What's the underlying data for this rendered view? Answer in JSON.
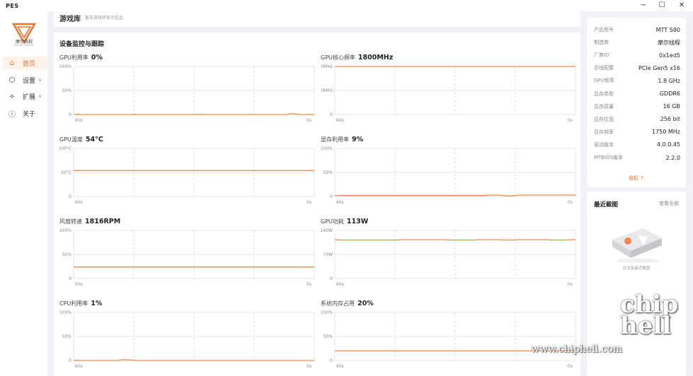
{
  "app": {
    "title": "PES"
  },
  "window": {
    "minimize": "−",
    "maximize": "☐",
    "close": "✕"
  },
  "logo": {
    "text": "摩尔线程",
    "subtext": "MOORE THREADS"
  },
  "sidebar": {
    "items": [
      {
        "label": "首页",
        "icon": "home-icon",
        "active": true
      },
      {
        "label": "设置",
        "icon": "settings-icon",
        "chevron": "∨"
      },
      {
        "label": "扩展",
        "icon": "extension-icon",
        "chevron": "∨"
      },
      {
        "label": "关于",
        "icon": "info-icon"
      }
    ]
  },
  "top_card": {
    "title": "游戏库",
    "subtitle": "暂无游戏将显示在此"
  },
  "monitor": {
    "title": "设备监控与跟踪",
    "charts": [
      {
        "label": "GPU利用率",
        "value": "0%",
        "y_ticks": [
          "100%",
          "50%",
          "0"
        ],
        "x_start": "60s",
        "x_end": "0s",
        "series": [
          0,
          0.4,
          0,
          0,
          0,
          0,
          0,
          0,
          0,
          0,
          0,
          0,
          0,
          0,
          0,
          0.3,
          0,
          0,
          0,
          0,
          0,
          0,
          0,
          0,
          0,
          0,
          0,
          0,
          0,
          0,
          0,
          0.3,
          0.5,
          0,
          0,
          0,
          0,
          0,
          0,
          0,
          0,
          0,
          0,
          0,
          0,
          0.5,
          0,
          0,
          0,
          0,
          0,
          0,
          0,
          0,
          1.5,
          1.5,
          0.5,
          0,
          0,
          0,
          0
        ]
      },
      {
        "label": "GPU核心频率",
        "value": "1800MHz",
        "y_ticks": [
          "1800MHz",
          "900MHz",
          "0"
        ],
        "x_start": "60s",
        "x_end": "0s",
        "series": [
          1800,
          1800,
          1800,
          1800,
          1800,
          1800,
          1800,
          1800,
          1800,
          1800,
          1800,
          1800,
          1800,
          1800,
          1800,
          1800,
          1800,
          1800,
          1800,
          1800,
          1800,
          1800,
          1800,
          1800,
          1800,
          1800,
          1800,
          1800,
          1800,
          1800,
          1800,
          1800,
          1800,
          1800,
          1800,
          1800,
          1800,
          1800,
          1800,
          1800,
          1800,
          1800,
          1800,
          1800,
          1800,
          1800,
          1800,
          1800,
          1800,
          1800,
          1800,
          1800,
          1800,
          1800,
          1800,
          1800,
          1800,
          1800,
          1800,
          1800,
          1800
        ],
        "y_max": 1800
      },
      {
        "label": "GPU温度",
        "value": "54°C",
        "y_ticks": [
          "100°C",
          "50°C",
          "0"
        ],
        "x_start": "60s",
        "x_end": "0s",
        "series": [
          54,
          54,
          54,
          54,
          54,
          54,
          54,
          54,
          54,
          54,
          54,
          54,
          54,
          54,
          54,
          54,
          54,
          54,
          54,
          54,
          54,
          54,
          54,
          54,
          54,
          54,
          54,
          54,
          54,
          54,
          54,
          54,
          54,
          54,
          54,
          54,
          54,
          54,
          54,
          54,
          54,
          54,
          54,
          54,
          54,
          54,
          54,
          54,
          54,
          54,
          54,
          54,
          54,
          54,
          54,
          54,
          54,
          54,
          54,
          54,
          54
        ]
      },
      {
        "label": "显存利用率",
        "value": "9%",
        "y_ticks": [
          "100%",
          "50%",
          "0"
        ],
        "x_start": "60s",
        "x_end": "0s",
        "series": [
          2,
          2,
          2,
          2,
          2,
          2,
          2,
          2,
          2,
          2,
          2,
          2,
          2,
          2,
          2,
          2,
          2,
          2,
          2,
          2,
          2,
          2,
          2,
          2,
          2,
          2,
          2,
          2,
          2,
          2,
          2,
          2,
          2,
          2,
          2,
          2,
          2,
          2,
          2.5,
          3,
          3,
          3,
          2,
          1,
          1,
          2,
          3,
          3,
          3,
          3,
          3,
          3,
          3,
          3,
          3,
          3,
          3,
          3,
          3,
          3,
          3
        ]
      },
      {
        "label": "风扇转速",
        "value": "1816RPM",
        "y_ticks": [
          "100%",
          "50%",
          "0"
        ],
        "x_start": "60s",
        "x_end": "0s",
        "series": [
          24,
          24,
          24,
          24,
          24,
          24,
          24,
          24,
          24,
          24,
          24,
          24,
          24,
          24,
          24,
          24,
          24,
          24,
          24,
          24,
          24,
          24,
          24,
          24,
          24,
          24,
          24,
          24,
          24,
          24,
          24,
          24,
          24,
          24,
          24,
          24,
          24,
          24,
          24,
          24,
          24,
          24,
          24,
          24,
          24,
          24,
          24,
          24,
          24,
          24,
          24,
          24,
          24,
          24,
          24,
          24,
          24,
          24,
          24,
          24,
          24
        ]
      },
      {
        "label": "GPU功耗",
        "value": "113W",
        "y_ticks": [
          "140W",
          "70W",
          "0"
        ],
        "x_start": "60s",
        "x_end": "0s",
        "series": [
          113,
          112,
          112,
          112,
          112,
          112,
          112,
          112,
          112,
          112,
          112,
          112,
          112,
          112,
          112,
          112,
          112,
          113,
          113,
          113,
          113,
          113,
          113,
          113,
          113,
          113,
          113,
          113,
          112,
          112,
          112,
          112,
          112,
          112,
          112,
          112,
          113,
          113,
          113,
          113,
          113,
          113,
          112,
          112,
          112,
          112,
          113,
          113,
          113,
          113,
          113,
          113,
          113,
          113,
          112,
          112,
          112,
          112,
          112,
          113,
          113
        ],
        "y_max": 140
      },
      {
        "label": "CPU利用率",
        "value": "1%",
        "y_ticks": [
          "100%",
          "50%",
          "0"
        ],
        "x_start": "60s",
        "x_end": "0s",
        "series": [
          0,
          0.5,
          0,
          0,
          0,
          0,
          0,
          0,
          0,
          0,
          0,
          0,
          1.5,
          1.5,
          1,
          0,
          0,
          0,
          0,
          0,
          0,
          0,
          0,
          0,
          0,
          0,
          0,
          0,
          0,
          0,
          0,
          0,
          0,
          0,
          0,
          0,
          0,
          0,
          0,
          0,
          0,
          0,
          0,
          0,
          0,
          0,
          0,
          0,
          0,
          0,
          0,
          0,
          0,
          0,
          0,
          0,
          0,
          0,
          0,
          0,
          0
        ]
      },
      {
        "label": "系统内存占用",
        "value": "20%",
        "y_ticks": [
          "100%",
          "50%",
          "0"
        ],
        "x_start": "60s",
        "x_end": "0s",
        "series": [
          20,
          20,
          20,
          20,
          20,
          20,
          20,
          20,
          20,
          20,
          20,
          20,
          20,
          20,
          20,
          20,
          20,
          20,
          20,
          20,
          20,
          20,
          20,
          20,
          20,
          20,
          20,
          20,
          20,
          20,
          20,
          20,
          20,
          20,
          20,
          20,
          20,
          20,
          20,
          20,
          20,
          20,
          20,
          20,
          20,
          20,
          20,
          20,
          20,
          20,
          20,
          20,
          20,
          20,
          20,
          20,
          20,
          20,
          20,
          20,
          20
        ]
      }
    ]
  },
  "specs": {
    "items": [
      {
        "k": "产品型号",
        "v": "MTT S80"
      },
      {
        "k": "制造商",
        "v": "摩尔线程"
      },
      {
        "k": "厂商ID",
        "v": "0x1ed5"
      },
      {
        "k": "总线配置",
        "v": "PCIe Gen5 x16"
      },
      {
        "k": "GPU频率",
        "v": "1.8 GHz"
      },
      {
        "k": "显存类型",
        "v": "GDDR6"
      },
      {
        "k": "显存容量",
        "v": "16 GB"
      },
      {
        "k": "显存位宽",
        "v": "256 bit"
      },
      {
        "k": "显存频率",
        "v": "1750 MHz"
      },
      {
        "k": "驱动版本",
        "v": "4.0.0.45"
      },
      {
        "k": "MTBIOS版本",
        "v": "2.2.0"
      }
    ],
    "collapse_label": "收起 ↑"
  },
  "screenshots": {
    "title": "最近截图",
    "view_all": "查看全部",
    "empty": "还没有最近截图"
  },
  "watermark": {
    "url": "www.chiphell.com",
    "brand": "chip hell"
  },
  "colors": {
    "accent": "#e8702a",
    "line": "#f08a4b"
  }
}
